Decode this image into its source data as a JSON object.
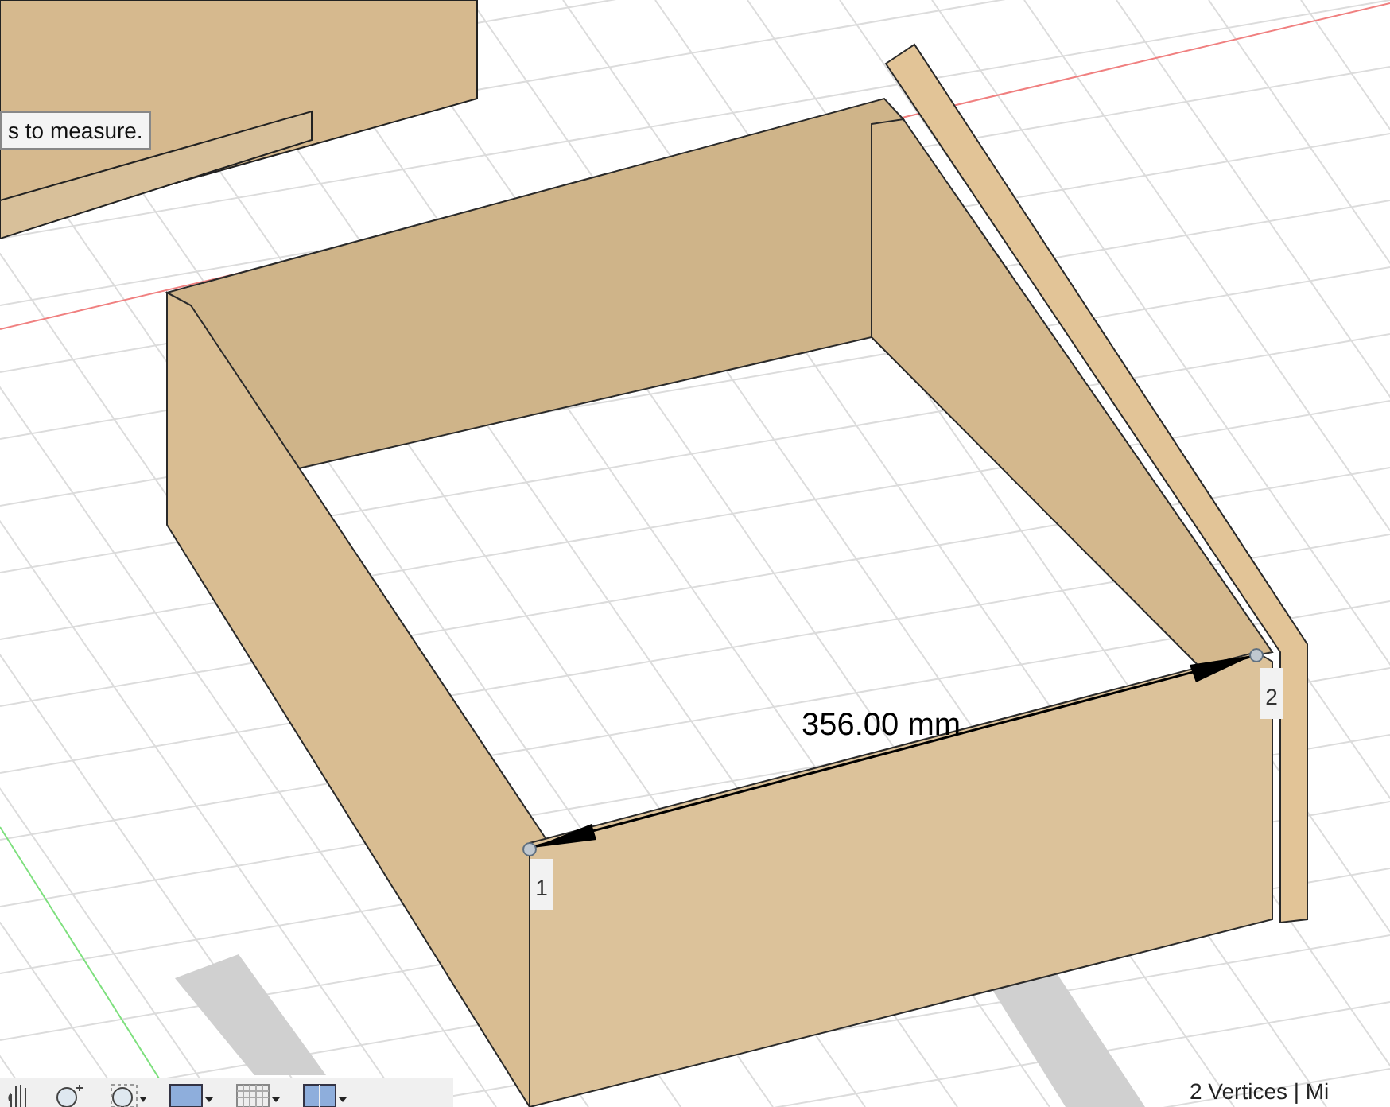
{
  "tooltip": {
    "text": "s to measure."
  },
  "measurement": {
    "value": "356.00 mm",
    "points": [
      {
        "label": "1"
      },
      {
        "label": "2"
      }
    ]
  },
  "status_text": "2 Vertices | Mi"
}
